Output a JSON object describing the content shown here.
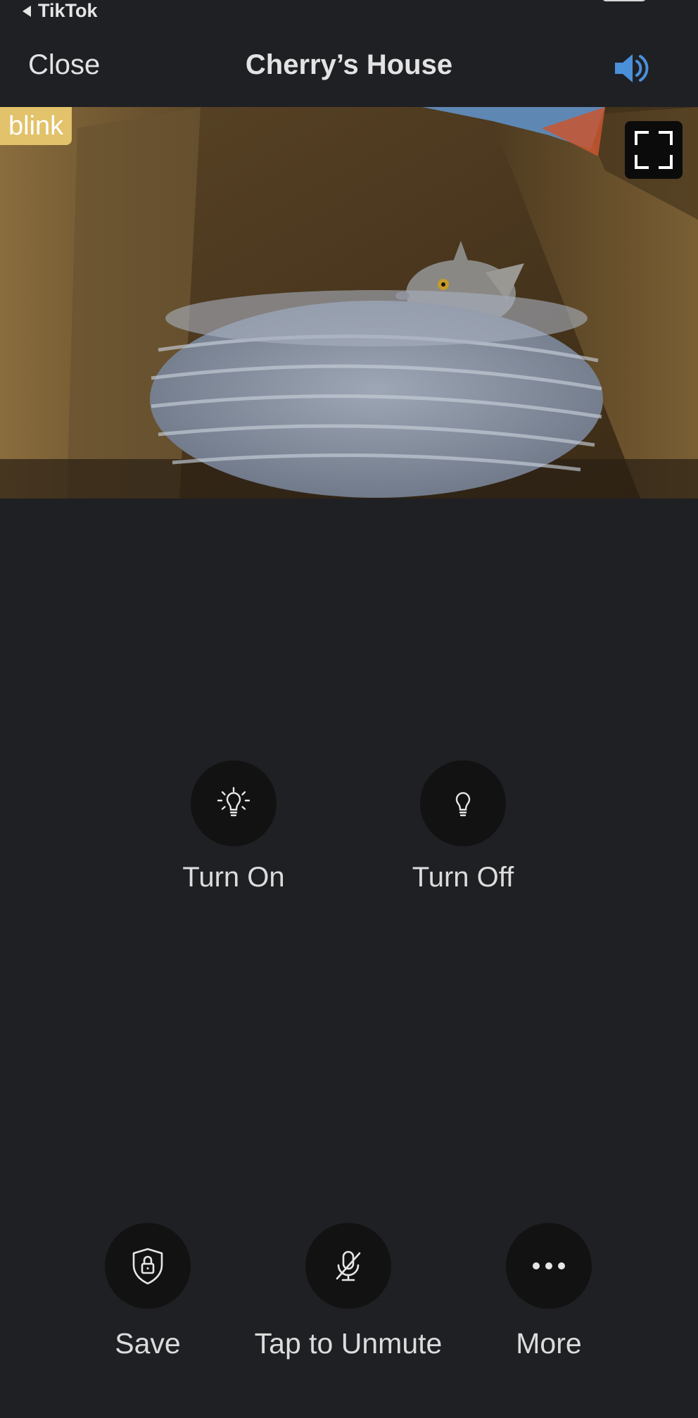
{
  "status_bar": {
    "back_app": "TikTok"
  },
  "header": {
    "close_label": "Close",
    "title": "Cherry’s House",
    "speaker_icon": "speaker-icon",
    "accent": "#4a90d9"
  },
  "camera": {
    "brand_badge": "blink",
    "badge_color": "#e2c26a",
    "fullscreen_icon": "fullscreen-icon"
  },
  "light_controls": [
    {
      "label": "Turn On",
      "icon": "lightbulb-on-icon"
    },
    {
      "label": "Turn Off",
      "icon": "lightbulb-off-icon"
    }
  ],
  "bottom_bar": [
    {
      "label": "Save",
      "icon": "shield-lock-icon"
    },
    {
      "label": "Tap to Unmute",
      "icon": "mic-muted-icon"
    },
    {
      "label": "More",
      "icon": "more-dots-icon"
    }
  ]
}
